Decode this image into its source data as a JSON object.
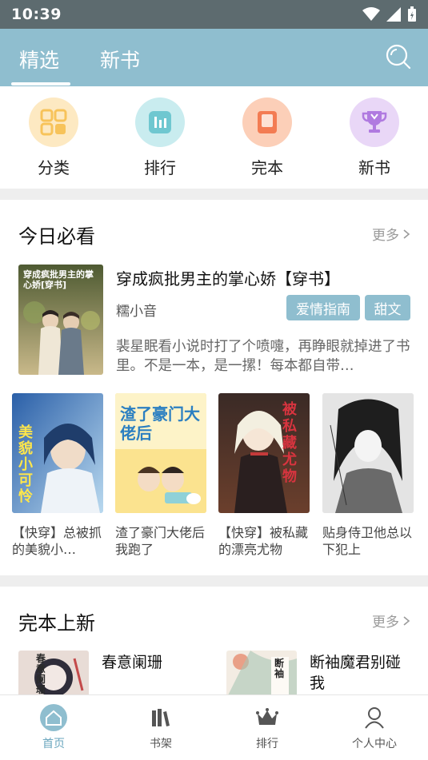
{
  "status_bar": {
    "time": "10:39"
  },
  "header": {
    "tabs": [
      {
        "label": "精选",
        "active": true
      },
      {
        "label": "新书",
        "active": false
      }
    ]
  },
  "quick_links": [
    {
      "label": "分类",
      "icon": "category-icon",
      "color": "#fde9c2"
    },
    {
      "label": "排行",
      "icon": "ranking-icon",
      "color": "#c9ecef"
    },
    {
      "label": "完本",
      "icon": "book-icon",
      "color": "#fccfb8"
    },
    {
      "label": "新书",
      "icon": "trophy-icon",
      "color": "#e9d7f7"
    }
  ],
  "today_section": {
    "title": "今日必看",
    "more": "更多",
    "featured": {
      "title": "穿成疯批男主的掌心娇【穿书】",
      "author": "糯小音",
      "tags": [
        "爱情指南",
        "甜文"
      ],
      "description": "裴星眠看小说时打了个喷嚏，再睁眼就掉进了书里。不是一本，是一摞！每本都自带…",
      "cover_text": "穿成疯批男主的掌心娇[穿书]"
    },
    "books": [
      {
        "title": "【快穿】总被抓的美貌小…",
        "cover_text": "美貌小可怜"
      },
      {
        "title": "渣了豪门大佬后我跑了",
        "cover_text": "渣了豪门大佬后"
      },
      {
        "title": "【快穿】被私藏的漂亮尤物",
        "cover_text": "被私藏尤物"
      },
      {
        "title": "贴身侍卫他总以下犯上",
        "cover_text": ""
      }
    ]
  },
  "complete_section": {
    "title": "完本上新",
    "more": "更多",
    "books": [
      {
        "title": "春意阑珊",
        "cover_text": "春意阑珊"
      },
      {
        "title": "断袖魔君别碰我",
        "cover_text": "断袖"
      }
    ]
  },
  "bottom_nav": [
    {
      "label": "首页",
      "icon": "home-icon",
      "active": true
    },
    {
      "label": "书架",
      "icon": "bookshelf-icon",
      "active": false
    },
    {
      "label": "排行",
      "icon": "crown-icon",
      "active": false
    },
    {
      "label": "个人中心",
      "icon": "person-icon",
      "active": false
    }
  ],
  "colors": {
    "accent": "#8fbecf",
    "status_bar": "#5d6b6f"
  }
}
